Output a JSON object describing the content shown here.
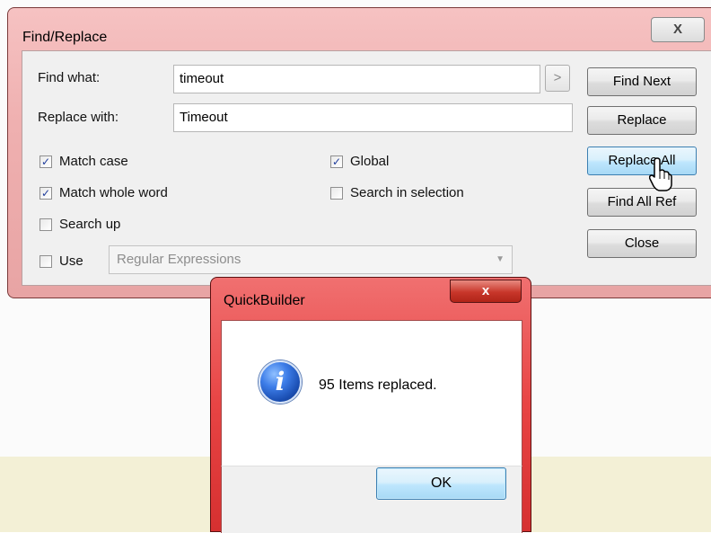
{
  "find_replace": {
    "title": "Find/Replace",
    "close_label": "X",
    "find_what_label": "Find what:",
    "find_what_value": "timeout",
    "arrow_label": ">",
    "replace_with_label": "Replace with:",
    "replace_with_value": "Timeout",
    "buttons": {
      "find_next": "Find Next",
      "replace": "Replace",
      "replace_all": "Replace All",
      "find_all_ref": "Find All Ref",
      "close": "Close"
    },
    "options": {
      "match_case": {
        "label": "Match case",
        "checked": true
      },
      "match_whole_word": {
        "label": "Match whole word",
        "checked": true
      },
      "search_up": {
        "label": "Search up",
        "checked": false
      },
      "global": {
        "label": "Global",
        "checked": true
      },
      "search_in_selection": {
        "label": "Search in selection",
        "checked": false
      },
      "use": {
        "label": "Use",
        "checked": false
      }
    },
    "use_combo_value": "Regular Expressions"
  },
  "message_box": {
    "title": "QuickBuilder",
    "close_label": "x",
    "icon": "info-icon",
    "message": "95 Items replaced.",
    "ok_label": "OK"
  }
}
